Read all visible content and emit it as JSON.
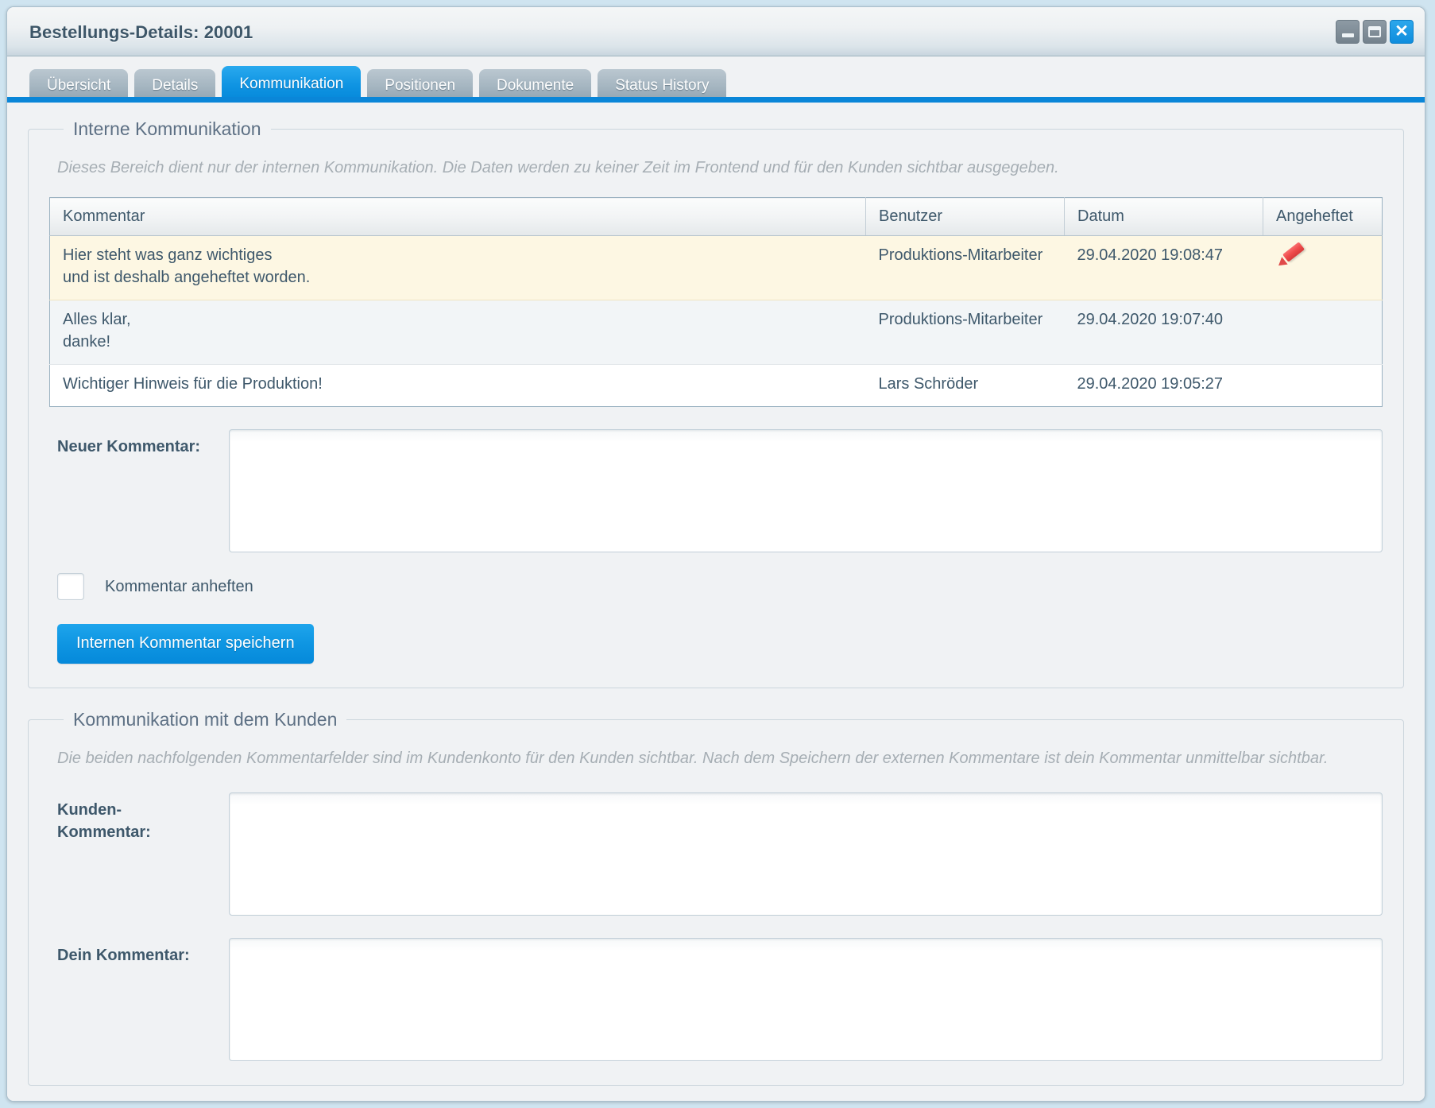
{
  "window": {
    "title": "Bestellungs-Details: 20001",
    "controls": {
      "minimize": "minimize-icon",
      "restore": "restore-icon",
      "close": "close-icon"
    }
  },
  "tabs": [
    {
      "label": "Übersicht",
      "active": false
    },
    {
      "label": "Details",
      "active": false
    },
    {
      "label": "Kommunikation",
      "active": true
    },
    {
      "label": "Positionen",
      "active": false
    },
    {
      "label": "Dokumente",
      "active": false
    },
    {
      "label": "Status History",
      "active": false
    }
  ],
  "internal": {
    "legend": "Interne Kommunikation",
    "hint": "Dieses Bereich dient nur der internen Kommunikation. Die Daten werden zu keiner Zeit im Frontend und für den Kunden sichtbar ausgegeben.",
    "table": {
      "headers": [
        "Kommentar",
        "Benutzer",
        "Datum",
        "Angeheftet"
      ],
      "rows": [
        {
          "comment_line1": "Hier steht was ganz wichtiges",
          "comment_line2": "und ist deshalb angeheftet worden.",
          "user": "Produktions-Mitarbeiter",
          "date": "29.04.2020 19:08:47",
          "pinned": true,
          "pin_icon": "pin-icon"
        },
        {
          "comment_line1": "Alles klar,",
          "comment_line2": "danke!",
          "user": "Produktions-Mitarbeiter",
          "date": "29.04.2020 19:07:40",
          "pinned": false,
          "pin_icon": ""
        },
        {
          "comment_line1": "Wichtiger Hinweis für die Produktion!",
          "comment_line2": "",
          "user": "Lars Schröder",
          "date": "29.04.2020 19:05:27",
          "pinned": false,
          "pin_icon": ""
        }
      ]
    },
    "new_comment_label": "Neuer Kommentar:",
    "new_comment_value": "",
    "pin_checkbox_label": "Kommentar anheften",
    "pin_checkbox_checked": false,
    "save_button": "Internen Kommentar speichern"
  },
  "customer": {
    "legend": "Kommunikation mit dem Kunden",
    "hint": "Die beiden nachfolgenden Kommentarfelder sind im Kundenkonto für den Kunden sichtbar. Nach dem Speichern der externen Kommentare ist dein Kommentar unmittelbar sichtbar.",
    "customer_comment_label_line1": "Kunden-",
    "customer_comment_label_line2": "Kommentar:",
    "customer_comment_value": "",
    "own_comment_label": "Dein Kommentar:",
    "own_comment_value": ""
  },
  "colors": {
    "accent_blue": "#0a86d8",
    "pinned_row": "#fdf7e3",
    "pin_red": "#ee4a4a",
    "text": "#3e586b",
    "hint_grey": "#a6aeb4",
    "window_bg": "#f0f2f4",
    "desktop_bg": "#cfe4f0"
  }
}
